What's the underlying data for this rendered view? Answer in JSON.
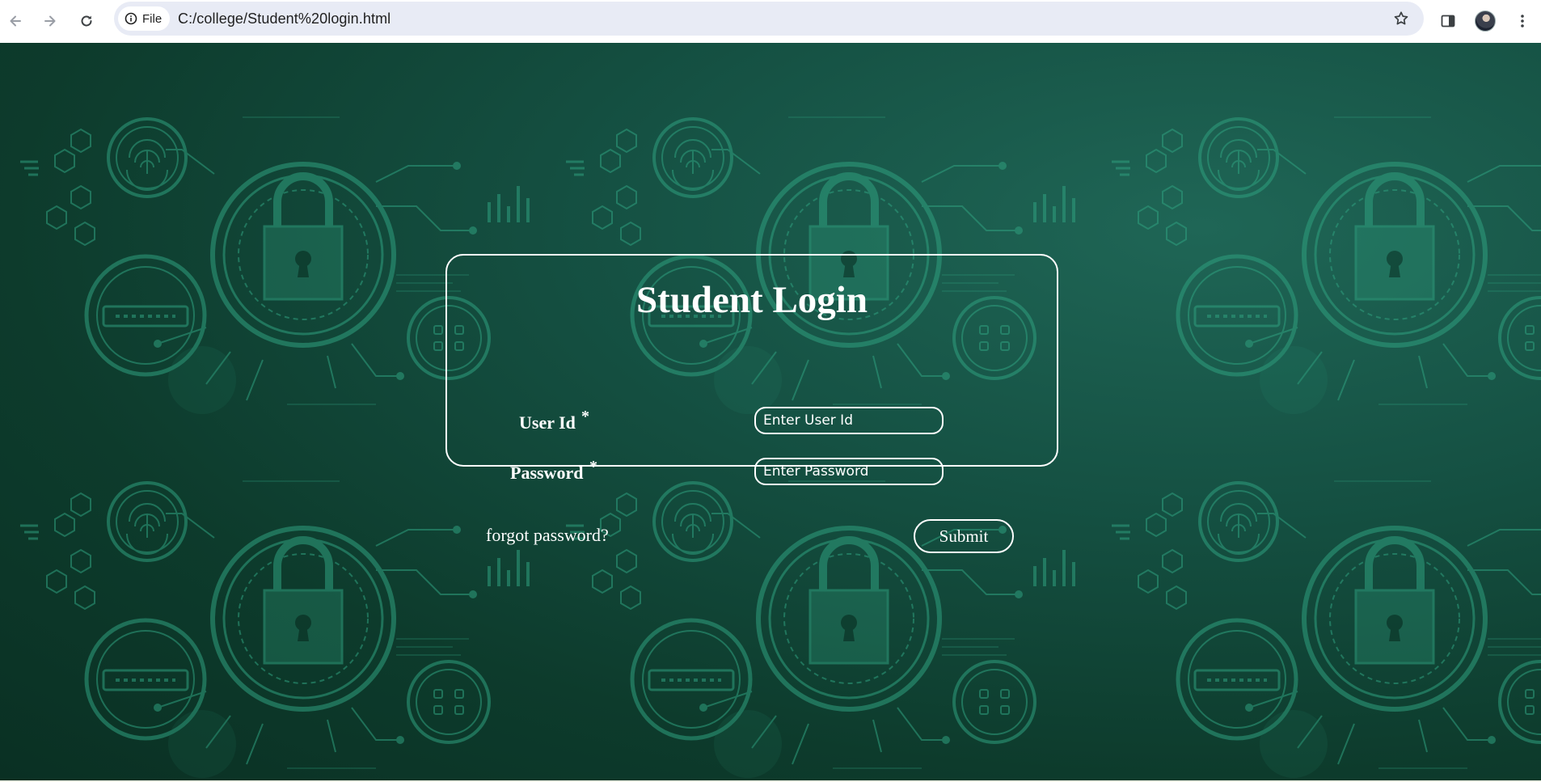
{
  "browser": {
    "site_chip_label": "File",
    "url": "C:/college/Student%20login.html",
    "icons": [
      "back-arrow-icon",
      "forward-arrow-icon",
      "reload-icon",
      "info-icon",
      "star-icon",
      "side-panel-icon",
      "avatar",
      "menu-kebab-icon"
    ]
  },
  "background": {
    "motif": "padlock-security",
    "colors": {
      "dark": "#0a3023",
      "mid": "#155143",
      "light": "#1f6656",
      "accent": "#2fa07f"
    },
    "password_tag_text": "Password"
  },
  "login": {
    "title": "Student Login",
    "user_id": {
      "label": "User Id",
      "required_mark": "*",
      "placeholder": "Enter User Id",
      "value": ""
    },
    "password": {
      "label": "Password",
      "required_mark": "*",
      "placeholder": "Enter Password",
      "value": ""
    },
    "forgot_link": "forgot password?",
    "submit_label": "Submit"
  }
}
